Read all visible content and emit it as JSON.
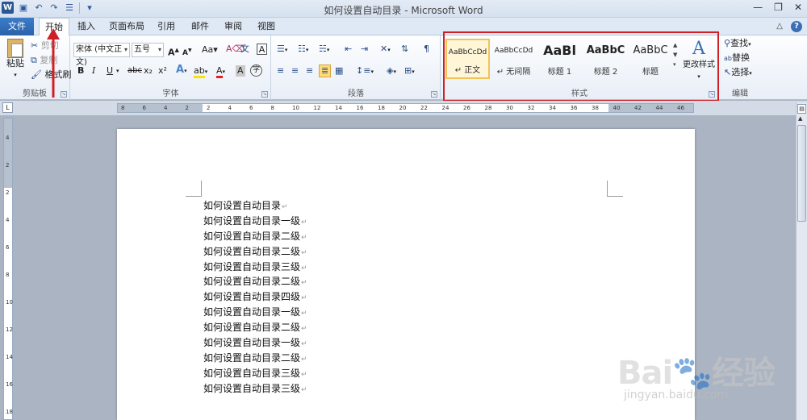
{
  "window": {
    "title": "如何设置自动目录 - Microsoft Word",
    "controls": {
      "minimize": "—",
      "restore": "❐",
      "close": "✕"
    }
  },
  "tabs": {
    "file": "文件",
    "items": [
      "开始",
      "插入",
      "页面布局",
      "引用",
      "邮件",
      "审阅",
      "视图"
    ],
    "active": "开始",
    "help": "?",
    "collapse": "△"
  },
  "ribbon": {
    "clipboard": {
      "label": "剪贴板",
      "paste": "粘贴",
      "cut": "剪切",
      "copy": "复制",
      "format_painter": "格式刷"
    },
    "font": {
      "label": "字体",
      "font_name": "宋体 (中文正文)",
      "font_size": "五号",
      "bold": "B",
      "italic": "I",
      "underline": "U",
      "strike": "abc",
      "subscript": "x₂",
      "superscript": "x²",
      "grow": "A",
      "shrink": "A",
      "change_case": "Aa",
      "clear_format": "A",
      "text_effect": "A",
      "highlight": "ab",
      "font_color": "A",
      "char_shading": "A",
      "enclose": "字"
    },
    "paragraph": {
      "label": "段落"
    },
    "styles": {
      "label": "样式",
      "tiles": [
        {
          "sample": "AaBbCcDd",
          "name": "↵ 正文"
        },
        {
          "sample": "AaBbCcDd",
          "name": "↵ 无间隔"
        },
        {
          "sample": "AaBl",
          "name": "标题 1"
        },
        {
          "sample": "AaBbC",
          "name": "标题 2"
        },
        {
          "sample": "AaBbC",
          "name": "标题"
        }
      ],
      "change_styles": "更改样式"
    },
    "editing": {
      "label": "编辑",
      "find": "查找",
      "replace": "替换",
      "select": "选择"
    }
  },
  "ruler": {
    "h_labels": [
      "8",
      "6",
      "4",
      "2",
      "2",
      "4",
      "6",
      "8",
      "10",
      "12",
      "14",
      "16",
      "18",
      "20",
      "22",
      "24",
      "26",
      "28",
      "30",
      "32",
      "34",
      "36",
      "38",
      "40",
      "42",
      "44",
      "46"
    ],
    "v_labels": [
      "4",
      "2",
      "2",
      "4",
      "6",
      "8",
      "10",
      "12",
      "14",
      "16",
      "18"
    ]
  },
  "document": {
    "paragraph_mark": "↵",
    "lines": [
      "如何设置自动目录",
      "如何设置自动目录一级",
      "如何设置自动目录二级",
      "如何设置自动目录二级",
      "如何设置自动目录三级",
      "如何设置自动目录二级",
      "如何设置自动目录四级",
      "如何设置自动目录一级",
      "如何设置自动目录二级",
      "如何设置自动目录一级",
      "如何设置自动目录二级",
      "如何设置自动目录三级",
      "如何设置自动目录三级"
    ]
  },
  "watermark": {
    "logo": "Bai🐾经验",
    "url": "jingyan.baidu.com"
  },
  "colors": {
    "file_tab": "#2a62aa",
    "annotation_red": "#d11f26",
    "selected_style": "#f0c35a"
  }
}
